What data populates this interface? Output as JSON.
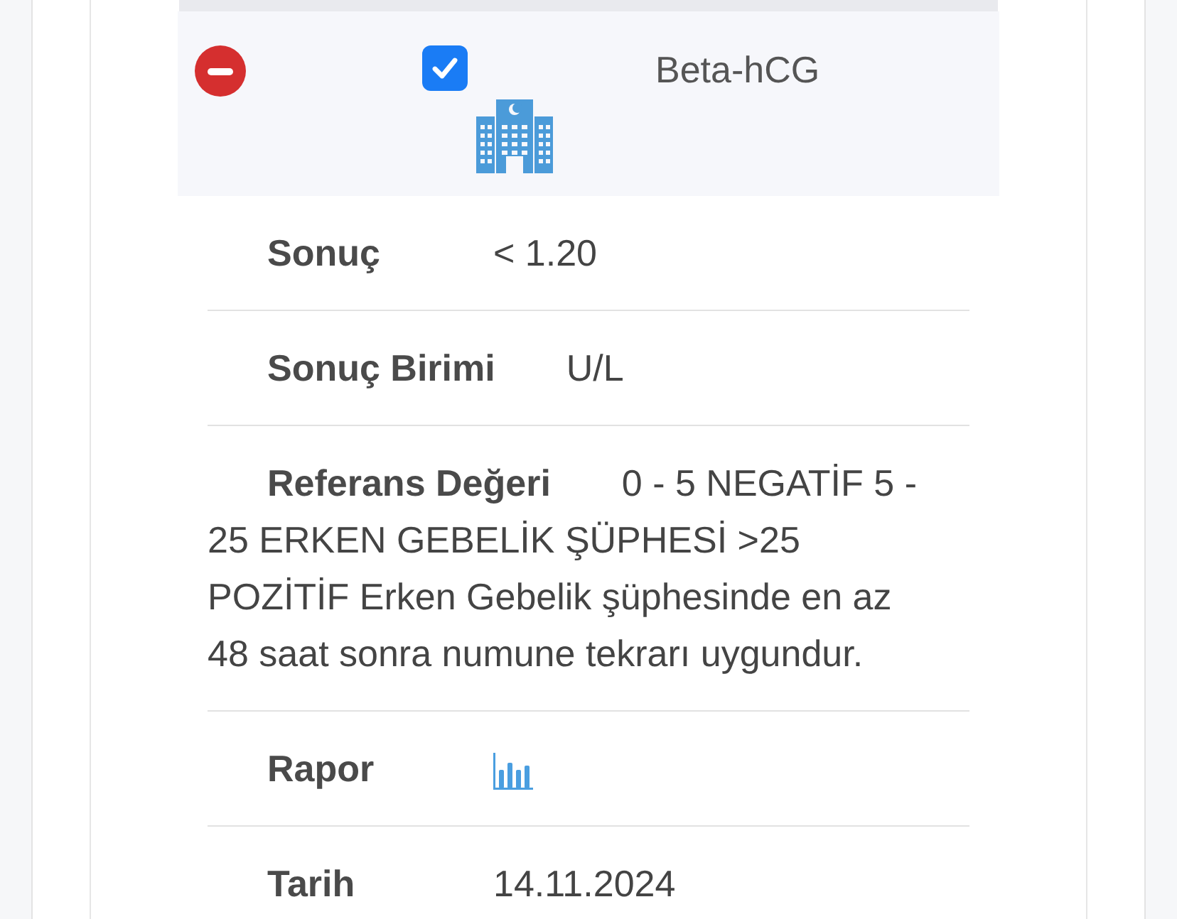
{
  "test": {
    "title": "Beta-hCG",
    "checked": true
  },
  "fields": [
    {
      "kind": "text",
      "label": "Sonuç",
      "value": "< 1.20"
    },
    {
      "kind": "text",
      "label": "Sonuç Birimi",
      "value": "U/L"
    },
    {
      "kind": "text",
      "label": "Referans Değeri",
      "value": "0 - 5 NEGATİF 5 - 25 ERKEN GEBELİK ŞÜPHESİ >25 POZİTİF Erken Gebelik şüphesinde en az 48 saat sonra numune tekrarı uygundur."
    },
    {
      "kind": "chart",
      "label": "Rapor"
    },
    {
      "kind": "text",
      "label": "Tarih",
      "value": "14.11.2024"
    }
  ]
}
